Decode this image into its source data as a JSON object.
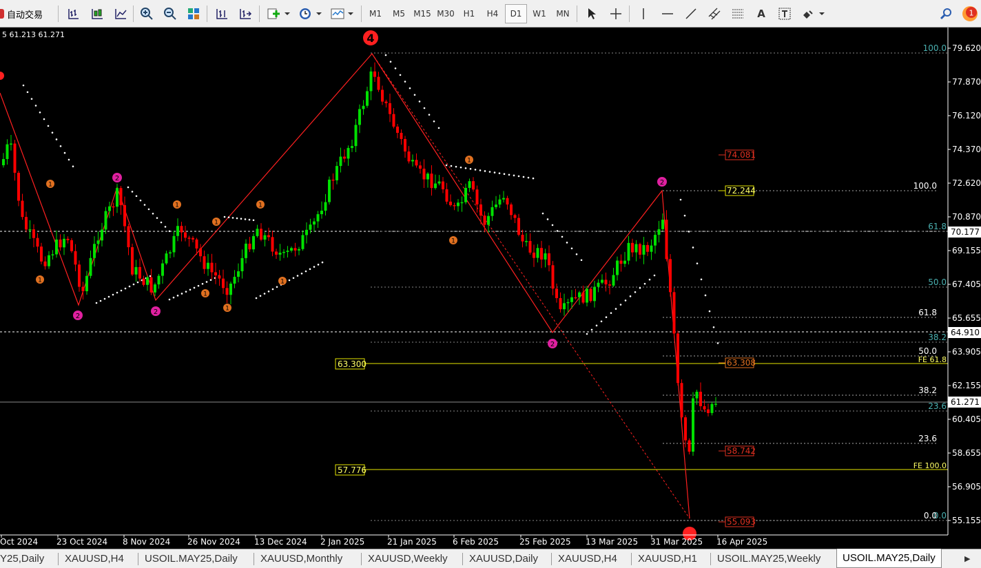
{
  "toolbar": {
    "autotrade_label": "自动交易",
    "timeframes": [
      {
        "label": "M1",
        "active": false
      },
      {
        "label": "M5",
        "active": false
      },
      {
        "label": "M15",
        "active": false
      },
      {
        "label": "M30",
        "active": false
      },
      {
        "label": "H1",
        "active": false
      },
      {
        "label": "H4",
        "active": false
      },
      {
        "label": "D1",
        "active": true
      },
      {
        "label": "W1",
        "active": false
      },
      {
        "label": "MN",
        "active": false
      }
    ],
    "notification_count": "1"
  },
  "chart": {
    "info_line": "5 61.213 61.271",
    "colors": {
      "background": "#000000",
      "bull_candle": "#00e000",
      "bear_candle": "#ff0000",
      "zigzag": "#ff2020",
      "fib": "#ffff66",
      "fib_cyan_label": "#4ab0b0",
      "sar_dots": "#ffffff",
      "wave_orange": "#e07020",
      "wave_magenta": "#e020a0",
      "current_price_bg": "#ffffff"
    },
    "price_axis": [
      "79.620",
      "77.870",
      "76.120",
      "74.370",
      "72.620",
      "70.870",
      "69.155",
      "67.405",
      "65.655",
      "63.905",
      "62.155",
      "60.405",
      "58.655",
      "56.905",
      "55.155"
    ],
    "price_tags": [
      {
        "label": "70.177"
      },
      {
        "label": "64.910"
      },
      {
        "label": "61.271"
      }
    ],
    "date_axis": [
      "Oct 2024",
      "23 Oct 2024",
      "8 Nov 2024",
      "26 Nov 2024",
      "13 Dec 2024",
      "2 Jan 2025",
      "21 Jan 2025",
      "6 Feb 2025",
      "25 Feb 2025",
      "13 Mar 2025",
      "31 Mar 2025",
      "16 Apr 2025"
    ],
    "hline_labels": {
      "left_top": "63.300",
      "left_bottom": "57.776"
    },
    "fe_labels": {
      "fe618": "FE 61.8",
      "fe100": "FE 100.0"
    },
    "fib_levels_primary": [
      {
        "label": "100.0"
      },
      {
        "label": "61.8"
      },
      {
        "label": "50.0"
      },
      {
        "label": "38.2"
      },
      {
        "label": "23.6"
      },
      {
        "label": "0.0"
      }
    ],
    "fib_levels_secondary": [
      {
        "label": "100.0"
      },
      {
        "label": "61.8"
      },
      {
        "label": "50.0"
      },
      {
        "label": "38.2"
      },
      {
        "label": "23.6"
      },
      {
        "label": "0.0"
      }
    ],
    "boxed_prices": [
      {
        "label": "74.081"
      },
      {
        "label": "72.244"
      },
      {
        "label": "63.308"
      },
      {
        "label": "58.742"
      },
      {
        "label": "55.093"
      }
    ],
    "wave_label_big": "4"
  },
  "tabs": [
    {
      "label": "Y25,Daily",
      "active": false
    },
    {
      "label": "XAUUSD,H4",
      "active": false
    },
    {
      "label": "USOIL.MAY25,Daily",
      "active": false
    },
    {
      "label": "XAUUSD,Monthly",
      "active": false
    },
    {
      "label": "XAUUSD,Weekly",
      "active": false
    },
    {
      "label": "XAUUSD,Daily",
      "active": false
    },
    {
      "label": "XAUUSD,H4",
      "active": false
    },
    {
      "label": "XAUUSD,H1",
      "active": false
    },
    {
      "label": "USOIL.MAY25,Weekly",
      "active": false
    },
    {
      "label": "USOIL.MAY25,Daily",
      "active": true
    }
  ]
}
